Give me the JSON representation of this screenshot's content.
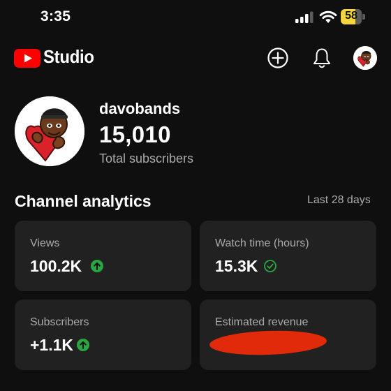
{
  "status_bar": {
    "time": "3:35",
    "battery": "58"
  },
  "header": {
    "app_name": "Studio",
    "brand_color": "#ff0000"
  },
  "channel": {
    "name": "davobands",
    "subscriber_count": "15,010",
    "subscriber_label": "Total subscribers"
  },
  "analytics": {
    "title": "Channel analytics",
    "range": "Last 28 days",
    "cards": [
      {
        "title": "Views",
        "value": "100.2K",
        "status_icon": "arrow-up-circle-icon",
        "status_color": "#2ba640"
      },
      {
        "title": "Watch time (hours)",
        "value": "15.3K",
        "status_icon": "check-circle-icon",
        "status_color": "#2ba640"
      },
      {
        "title": "Subscribers",
        "value": "+1.1K",
        "status_icon": "arrow-up-circle-icon",
        "status_color": "#2ba640"
      },
      {
        "title": "Estimated revenue",
        "value": "",
        "redacted": true,
        "redaction_color": "#e02a0a"
      }
    ]
  }
}
